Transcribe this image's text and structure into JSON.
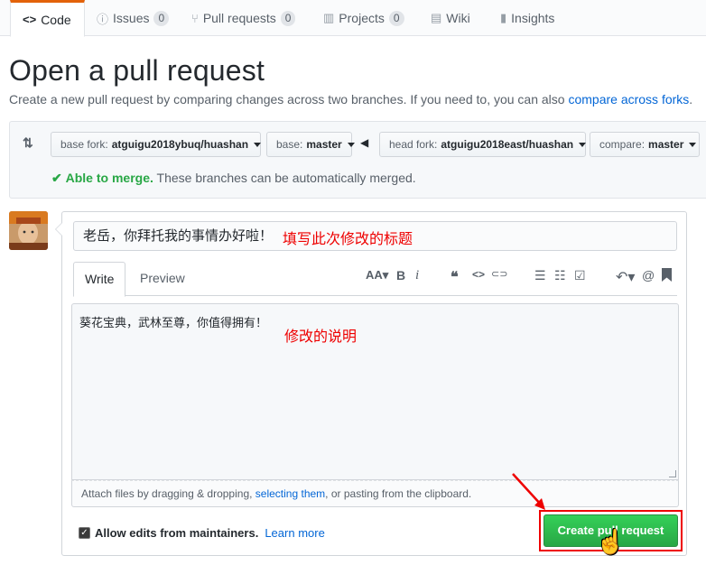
{
  "tabs": [
    {
      "label": "Code",
      "icon": "code-icon",
      "count": null
    },
    {
      "label": "Issues",
      "icon": "issue-icon",
      "count": "0"
    },
    {
      "label": "Pull requests",
      "icon": "pull-request-icon",
      "count": "0"
    },
    {
      "label": "Projects",
      "icon": "project-icon",
      "count": "0"
    },
    {
      "label": "Wiki",
      "icon": "book-icon",
      "count": null
    },
    {
      "label": "Insights",
      "icon": "graph-icon",
      "count": null
    }
  ],
  "page": {
    "title": "Open a pull request",
    "subtitle_text": "Create a new pull request by comparing changes across two branches. If you need to, you can also",
    "subtitle_link": "compare across forks",
    "subtitle_end": "."
  },
  "compare": {
    "base_fork_label": "base fork:",
    "base_fork_value": "atguigu2018ybuq/huashan",
    "base_label": "base:",
    "base_value": "master",
    "head_fork_label": "head fork:",
    "head_fork_value": "atguigu2018east/huashan",
    "compare_label": "compare:",
    "compare_value": "master",
    "merge_status": "Able to merge.",
    "merge_message": "These branches can be automatically merged."
  },
  "form": {
    "title_value": "老岳，你拜托我的事情办好啦！",
    "title_annotation": "填写此次修改的标题",
    "tab_write": "Write",
    "tab_preview": "Preview",
    "body_value": "葵花宝典，武林至尊，你值得拥有！",
    "body_annotation": "修改的说明",
    "attach_prefix": "Attach files by dragging & dropping,",
    "attach_link": "selecting them",
    "attach_suffix": ", or pasting from the clipboard.",
    "allow_edits_label": "Allow edits from maintainers.",
    "learn_more": "Learn more",
    "allow_edits_checked": true,
    "create_button": "Create pull request"
  },
  "toolbar": {
    "header": "AA",
    "bold": "B",
    "italic": "i",
    "quote": "❝",
    "code": "<>",
    "link": "⊂⊃",
    "ul": "☰",
    "ol": "☷",
    "tasks": "☑",
    "reply": "↶",
    "mention": "@",
    "bookmark": "🔖"
  },
  "colors": {
    "accent_orange": "#e36209",
    "link_blue": "#0366d6",
    "success_green": "#28a745",
    "annotation_red": "#ee0000"
  }
}
